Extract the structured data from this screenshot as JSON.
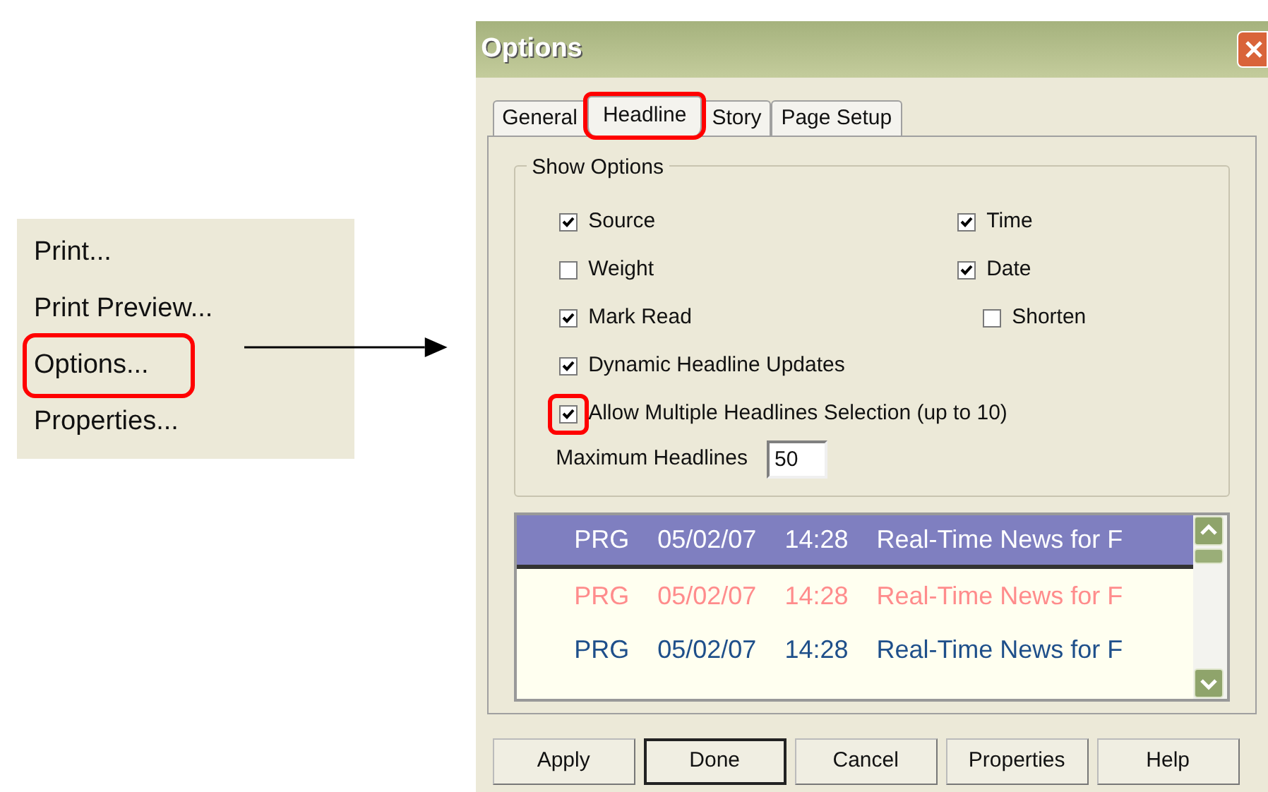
{
  "menu": {
    "items": [
      {
        "label": "Print...",
        "highlighted": false
      },
      {
        "label": "Print Preview...",
        "highlighted": false
      },
      {
        "label": "Options...",
        "highlighted": true
      },
      {
        "label": "Properties...",
        "highlighted": false
      }
    ]
  },
  "dialog": {
    "title": "Options",
    "tabs": [
      {
        "label": "General",
        "selected": false,
        "highlighted": false
      },
      {
        "label": "Headline",
        "selected": true,
        "highlighted": true
      },
      {
        "label": "Story",
        "selected": false,
        "highlighted": false
      },
      {
        "label": "Page Setup",
        "selected": false,
        "highlighted": false
      }
    ],
    "group": {
      "title": "Show Options",
      "left_options": [
        {
          "label": "Source",
          "checked": true,
          "highlighted": false
        },
        {
          "label": "Weight",
          "checked": false,
          "highlighted": false
        },
        {
          "label": "Mark Read",
          "checked": true,
          "highlighted": false
        },
        {
          "label": "Dynamic Headline Updates",
          "checked": true,
          "highlighted": false
        },
        {
          "label": "Allow Multiple Headlines Selection (up to 10)",
          "checked": true,
          "highlighted": true
        }
      ],
      "right_options": [
        {
          "label": "Time",
          "checked": true,
          "highlighted": false
        },
        {
          "label": "Date",
          "checked": true,
          "highlighted": false,
          "children": [
            {
              "label": "Shorten",
              "checked": false,
              "highlighted": false
            }
          ]
        }
      ],
      "max_headlines": {
        "label": "Maximum Headlines",
        "value": "50"
      }
    },
    "headlines": [
      {
        "source": "PRG",
        "date": "05/02/07",
        "time": "14:28",
        "title": "Real-Time News for F",
        "selected": true,
        "color": "#ffffff"
      },
      {
        "source": "PRG",
        "date": "05/02/07",
        "time": "14:28",
        "title": "Real-Time News for F",
        "selected": false,
        "color": "#ff8c8c"
      },
      {
        "source": "PRG",
        "date": "05/02/07",
        "time": "14:28",
        "title": "Real-Time News for F",
        "selected": false,
        "color": "#1e4f8a"
      }
    ],
    "buttons": [
      {
        "label": "Apply",
        "default": false
      },
      {
        "label": "Done",
        "default": true
      },
      {
        "label": "Cancel",
        "default": false
      },
      {
        "label": "Properties",
        "default": false
      },
      {
        "label": "Help",
        "default": false
      }
    ]
  }
}
